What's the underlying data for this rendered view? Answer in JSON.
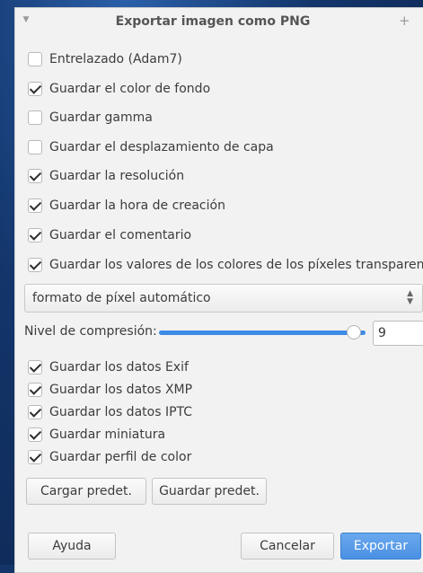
{
  "dialog": {
    "title": "Exportar imagen como PNG",
    "menu_icon": "chevron-down-icon",
    "pin_icon": "plus-icon"
  },
  "options": [
    {
      "label": "Entrelazado (Adam7)",
      "checked": false
    },
    {
      "label": "Guardar el color de fondo",
      "checked": true
    },
    {
      "label": "Guardar gamma",
      "checked": false
    },
    {
      "label": "Guardar el desplazamiento de capa",
      "checked": false
    },
    {
      "label": "Guardar la resolución",
      "checked": true
    },
    {
      "label": "Guardar la hora de creación",
      "checked": true
    },
    {
      "label": "Guardar el comentario",
      "checked": true
    },
    {
      "label": "Guardar los valores de los colores de los píxeles transparentes",
      "checked": true
    }
  ],
  "pixel_format": {
    "selected": "formato de píxel automático"
  },
  "compression": {
    "label": "Nivel de compresión:",
    "value": "9",
    "max": 9,
    "fraction": 1.0
  },
  "metadata_options": [
    {
      "label": "Guardar los datos Exif",
      "checked": true
    },
    {
      "label": "Guardar los datos XMP",
      "checked": true
    },
    {
      "label": "Guardar los datos IPTC",
      "checked": true
    },
    {
      "label": "Guardar miniatura",
      "checked": true
    },
    {
      "label": "Guardar perfil de color",
      "checked": true
    }
  ],
  "defaults_buttons": {
    "load": "Cargar predet.",
    "save": "Guardar predet."
  },
  "footer": {
    "help": "Ayuda",
    "cancel": "Cancelar",
    "export": "Exportar"
  },
  "colors": {
    "accent": "#4a90e2",
    "dialog_bg": "#f2f2f2",
    "desktop_bg": "#13356a"
  }
}
